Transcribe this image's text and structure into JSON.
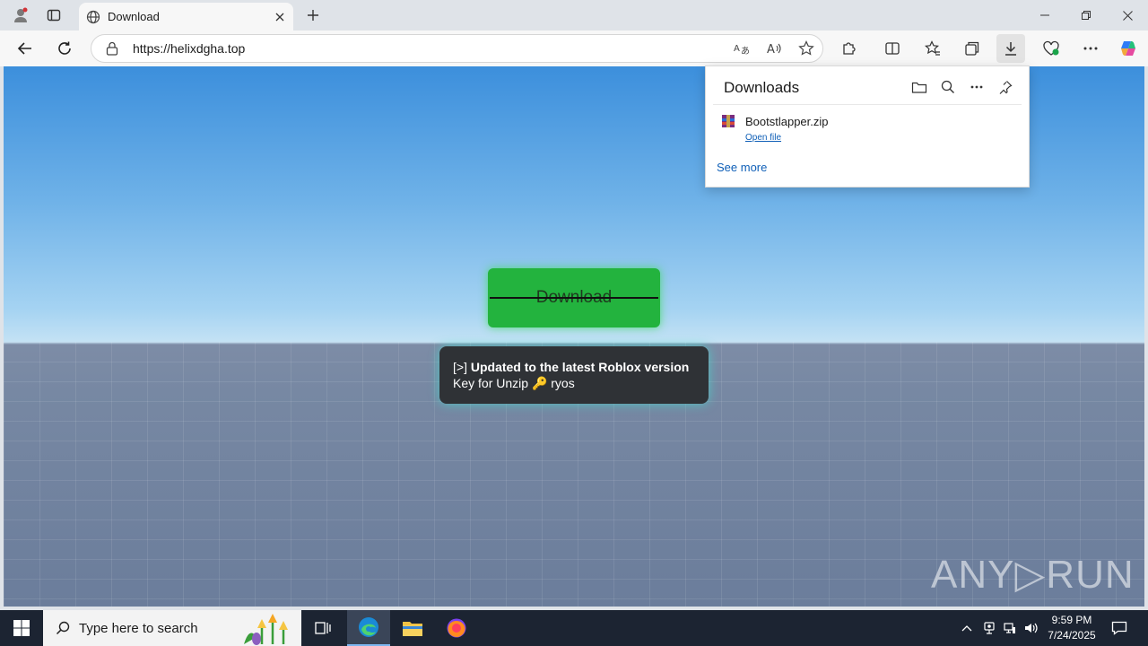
{
  "browser": {
    "tab_title": "Download",
    "url": "https://helixdgha.top"
  },
  "page": {
    "download_label": "Download",
    "notice_prefix": "[>]",
    "notice_bold": "Updated to the latest Roblox version",
    "notice_line2_a": "Key for Unzip",
    "notice_key_glyph": "🔑",
    "notice_line2_b": "ryos",
    "watermark": "ANY▷RUN"
  },
  "downloads": {
    "title": "Downloads",
    "file_name": "Bootstlapper.zip",
    "open_file": "Open file",
    "see_more": "See more"
  },
  "taskbar": {
    "search_placeholder": "Type here to search",
    "time": "9:59 PM",
    "date": "7/24/2025"
  },
  "colors": {
    "accent_green": "#23b33e",
    "link_blue": "#0f5fb7",
    "taskbar": "#1c2432"
  }
}
